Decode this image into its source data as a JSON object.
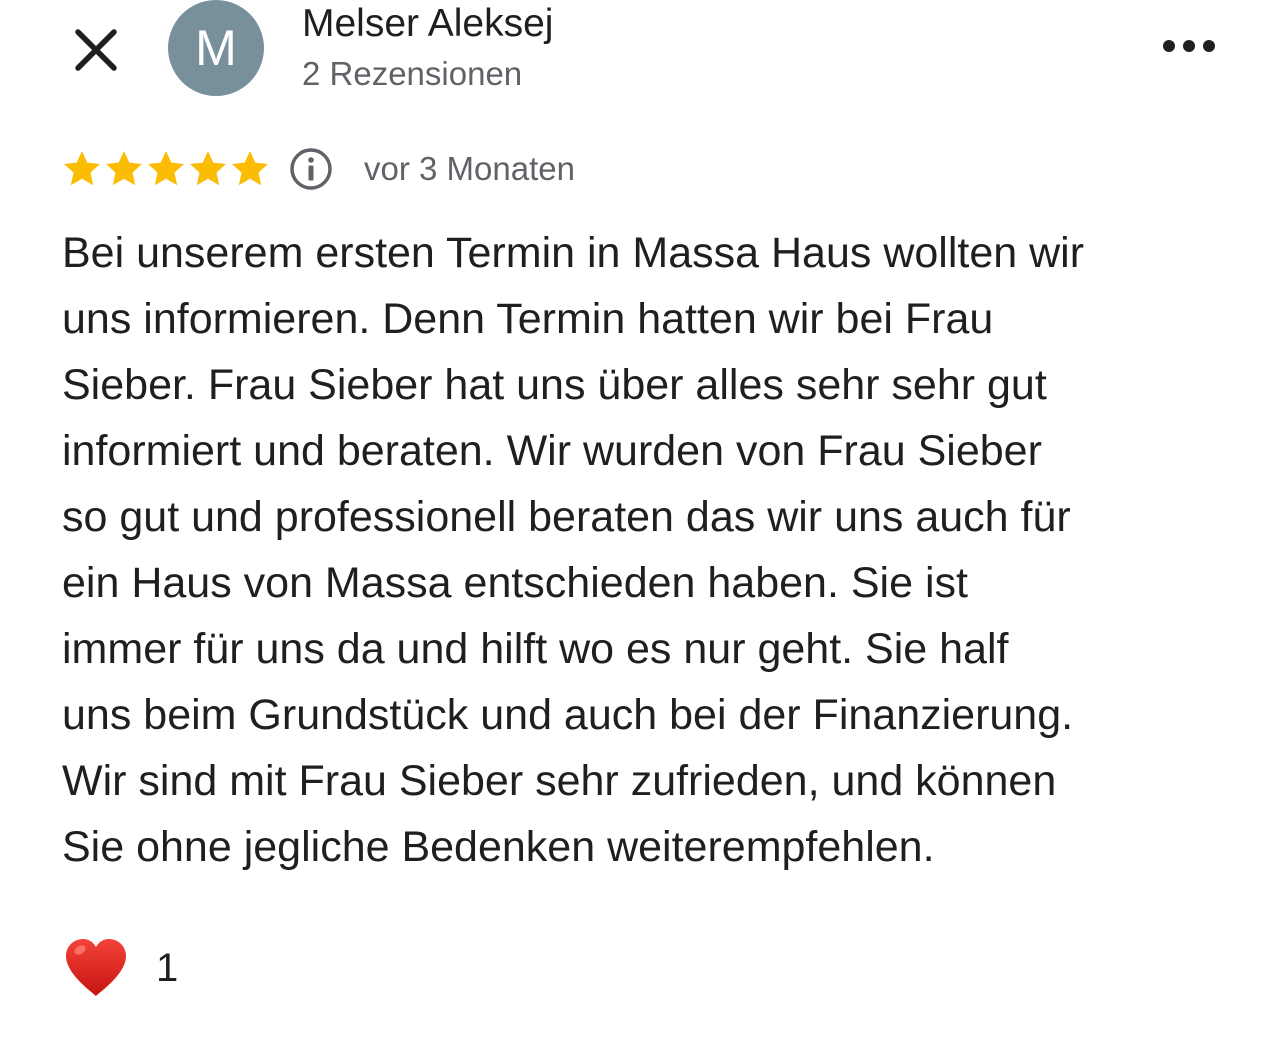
{
  "header": {
    "avatar_initial": "M",
    "avatar_color": "#78909c",
    "user_name": "Melser Aleksej",
    "review_count": "2 Rezensionen",
    "close_icon": "close-icon",
    "more_icon": "more-horizontal-icon"
  },
  "review": {
    "rating": 5,
    "max_rating": 5,
    "star_color": "#fbbc04",
    "info_icon": "info-icon",
    "time_ago": "vor 3 Monaten",
    "text": "Bei unserem ersten Termin in Massa Haus wollten wir\nuns informieren. Denn Termin hatten wir bei Frau\nSieber. Frau Sieber hat uns über alles sehr sehr gut\ninformiert und beraten. Wir wurden von Frau Sieber\nso gut und professionell beraten das wir uns auch für\nein Haus von Massa entschieden haben. Sie ist\nimmer für uns da und hilft wo es nur geht. Sie half\nuns beim Grundstück und auch bei der Finanzierung.\nWir sind mit Frau Sieber sehr zufrieden, und können\nSie ohne jegliche Bedenken weiterempfehlen."
  },
  "reactions": {
    "icon": "heart-icon",
    "heart_color": "#e0201b",
    "count": "1"
  }
}
